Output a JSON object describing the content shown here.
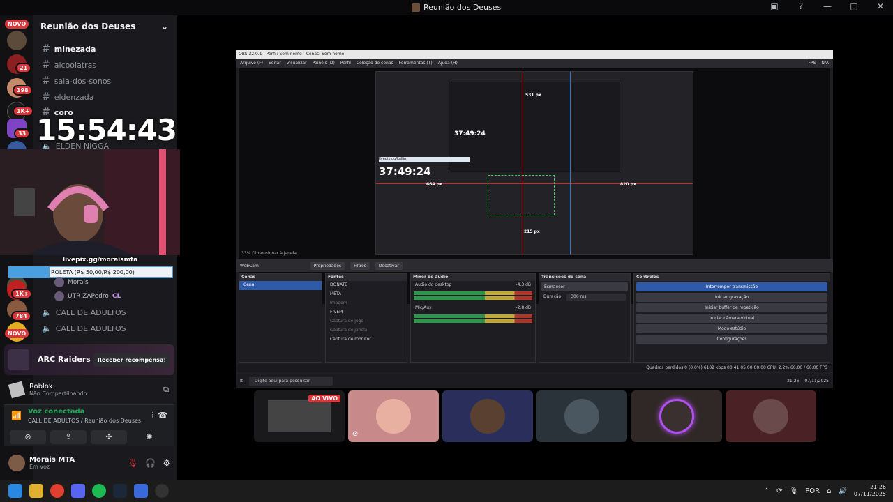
{
  "window": {
    "title": "Reunião dos Deuses"
  },
  "rail": {
    "badges": [
      "NOVO",
      "21",
      "198",
      "1K+",
      "33",
      "1K+",
      "784",
      "NOVO"
    ]
  },
  "sidebar": {
    "server_name": "Reunião dos Deuses",
    "channels": [
      {
        "name": "minezada",
        "active": true
      },
      {
        "name": "alcoolatras",
        "active": false
      },
      {
        "name": "sala-dos-sonos",
        "active": false
      },
      {
        "name": "eldenzada",
        "active": false
      },
      {
        "name": "coro",
        "active": true
      }
    ],
    "voice_channels": [
      "ELDEN NIGGA",
      "CALL DE ADULTOS",
      "CALL DE ADULTOS"
    ],
    "voice_users": [
      "Morais",
      "UTR ZAPedro"
    ],
    "voice_user_tag": "CL"
  },
  "overlay": {
    "clock": "15:54:43",
    "livepix": "livepix.gg/moraismta",
    "roleta": "ROLETA (R$ 50,00/R$ 200,00)"
  },
  "promo": {
    "brand": "ARC Raiders",
    "button": "Receber recompensa!"
  },
  "activity": {
    "game": "Roblox",
    "status": "Não Compartilhando"
  },
  "voice": {
    "status": "Voz conectada",
    "channel": "CALL DE ADULTOS / Reunião dos Deuses"
  },
  "user": {
    "name": "Morais MTA",
    "status": "Em voz"
  },
  "obs": {
    "title": "OBS 32.0.1 - Perfil: Sem nome - Cenas: Sem nome",
    "menu": [
      "Arquivo (F)",
      "Editar",
      "Visualizar",
      "Painéis (D)",
      "Perfil",
      "Coleção de cenas",
      "Ferramentas (T)",
      "Ajuda (H)"
    ],
    "fps_label": "FPS",
    "fps_value": "N/A",
    "timer": "37:49:24",
    "guide_labels": [
      "531 px",
      "664 px",
      "820 px",
      "215 px"
    ],
    "inner_text": "livepix.gg/kallin",
    "source_label": "WebCam",
    "source_buttons": [
      "Propriedades",
      "Filtros",
      "Desativar"
    ],
    "zoom": "33%",
    "zoom_mode": "Dimensionar à janela",
    "docks": {
      "scenes": {
        "title": "Cenas",
        "items": [
          "Cena"
        ]
      },
      "sources": {
        "title": "Fontes",
        "items": [
          "DONATE",
          "META",
          "Imagem",
          "FIVEM",
          "Captura de jogo",
          "Captura de janela",
          "Captura de monitor"
        ]
      },
      "mixer": {
        "title": "Mixer de áudio",
        "tracks": [
          {
            "name": "Áudio do desktop",
            "db": "-4.3 dB"
          },
          {
            "name": "Mic/Aux",
            "db": "-2.8 dB"
          }
        ]
      },
      "transitions": {
        "title": "Transições de cena",
        "type": "Esmaecer",
        "duration_label": "Duração",
        "duration": "300 ms"
      },
      "controls": {
        "title": "Controles",
        "buttons": [
          "Interromper transmissão",
          "Iniciar gravação",
          "Iniciar buffer de repetição",
          "Iniciar câmera virtual",
          "Modo estúdio",
          "Configurações"
        ]
      }
    },
    "status": "Quadros perdidos 0 (0.0%)   6102 kbps   00:41:05   00:00:00   CPU: 2.2%   60.00 / 60.00 FPS",
    "taskbar_search": "Digite aqui para pesquisar",
    "taskbar_time": "21:26",
    "taskbar_date": "07/11/2025"
  },
  "participants": {
    "live_label": "AO VIVO"
  },
  "taskbar": {
    "lang": "POR",
    "time": "21:26",
    "date": "07/11/2025"
  }
}
